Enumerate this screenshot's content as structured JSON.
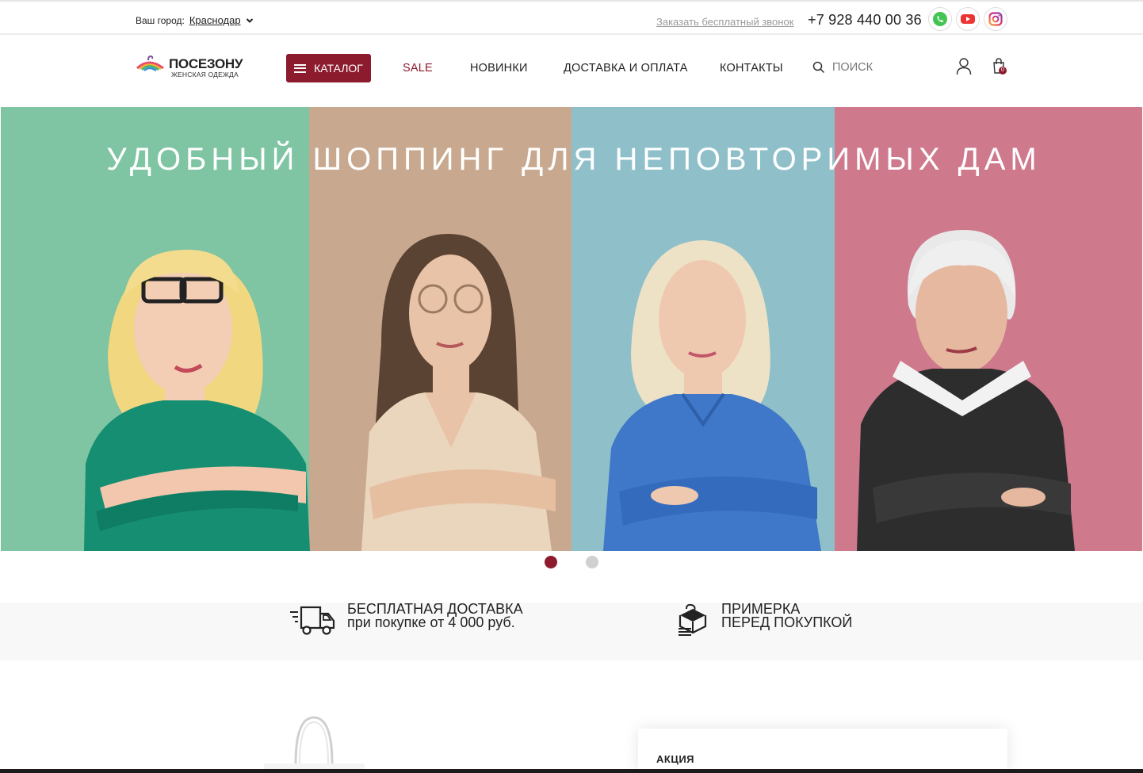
{
  "topbar": {
    "city_label": "Ваш город:",
    "city_value": "Краснодар",
    "callback_link": "Заказать бесплатный звонок",
    "phone": "+7 928 440 00 36",
    "socials": [
      "whatsapp-icon",
      "youtube-icon",
      "instagram-icon"
    ]
  },
  "header": {
    "logo_name": "ПОСЕЗОНУ",
    "logo_sub": "ЖЕНСКАЯ ОДЕЖДА",
    "catalog_label": "КАТАЛОГ",
    "nav": {
      "sale": "SALE",
      "new": "НОВИНКИ",
      "delivery": "ДОСТАВКА И ОПЛАТА",
      "contacts": "КОНТАКТЫ"
    },
    "search_label": "ПОИСК",
    "cart_count": "0"
  },
  "hero": {
    "title": "УДОБНЫЙ ШОППИНГ ДЛЯ НЕПОВТОРИМЫХ ДАМ",
    "slides_total": 2,
    "active_slide": 1,
    "panel_colors": [
      "#7fc4a3",
      "#c8a98f",
      "#8fc0c9",
      "#cf798d"
    ]
  },
  "features": [
    {
      "icon": "delivery-truck-icon",
      "line1": "БЕСПЛАТНАЯ ДОСТАВКА",
      "line2": "при покупке от 4 000 руб."
    },
    {
      "icon": "fitting-box-icon",
      "line1": "ПРИМЕРКА",
      "line2": "ПЕРЕД ПОКУПКОЙ"
    }
  ],
  "promo": {
    "label": "АКЦИЯ"
  },
  "colors": {
    "accent": "#8d1b2e",
    "text": "#222222",
    "muted": "#9a9a9a"
  }
}
